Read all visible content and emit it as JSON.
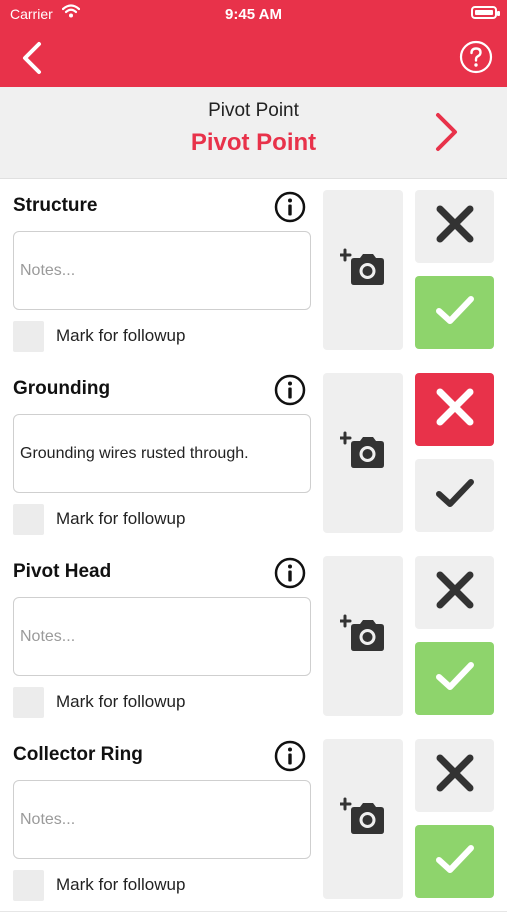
{
  "status_bar": {
    "carrier": "Carrier",
    "time": "9:45 AM"
  },
  "nav": {
    "back_icon": "chevron-left-icon",
    "help_icon": "question-circle-icon"
  },
  "header": {
    "subtitle": "Pivot Point",
    "title": "Pivot Point",
    "next_icon": "chevron-right-icon"
  },
  "colors": {
    "brand_red": "#e8324a",
    "pass_green": "#8ed46c",
    "neutral_gray": "#efefef",
    "icon_dark": "#333333"
  },
  "items": [
    {
      "name": "Structure",
      "notes": "",
      "notes_placeholder": "Notes...",
      "followup_label": "Mark for followup",
      "followup_checked": false,
      "result": "pass"
    },
    {
      "name": "Grounding",
      "notes": "Grounding wires rusted through.",
      "notes_placeholder": "Notes...",
      "followup_label": "Mark for followup",
      "followup_checked": false,
      "result": "fail"
    },
    {
      "name": "Pivot Head",
      "notes": "",
      "notes_placeholder": "Notes...",
      "followup_label": "Mark for followup",
      "followup_checked": false,
      "result": "pass"
    },
    {
      "name": "Collector Ring",
      "notes": "",
      "notes_placeholder": "Notes...",
      "followup_label": "Mark for followup",
      "followup_checked": false,
      "result": "pass"
    }
  ]
}
